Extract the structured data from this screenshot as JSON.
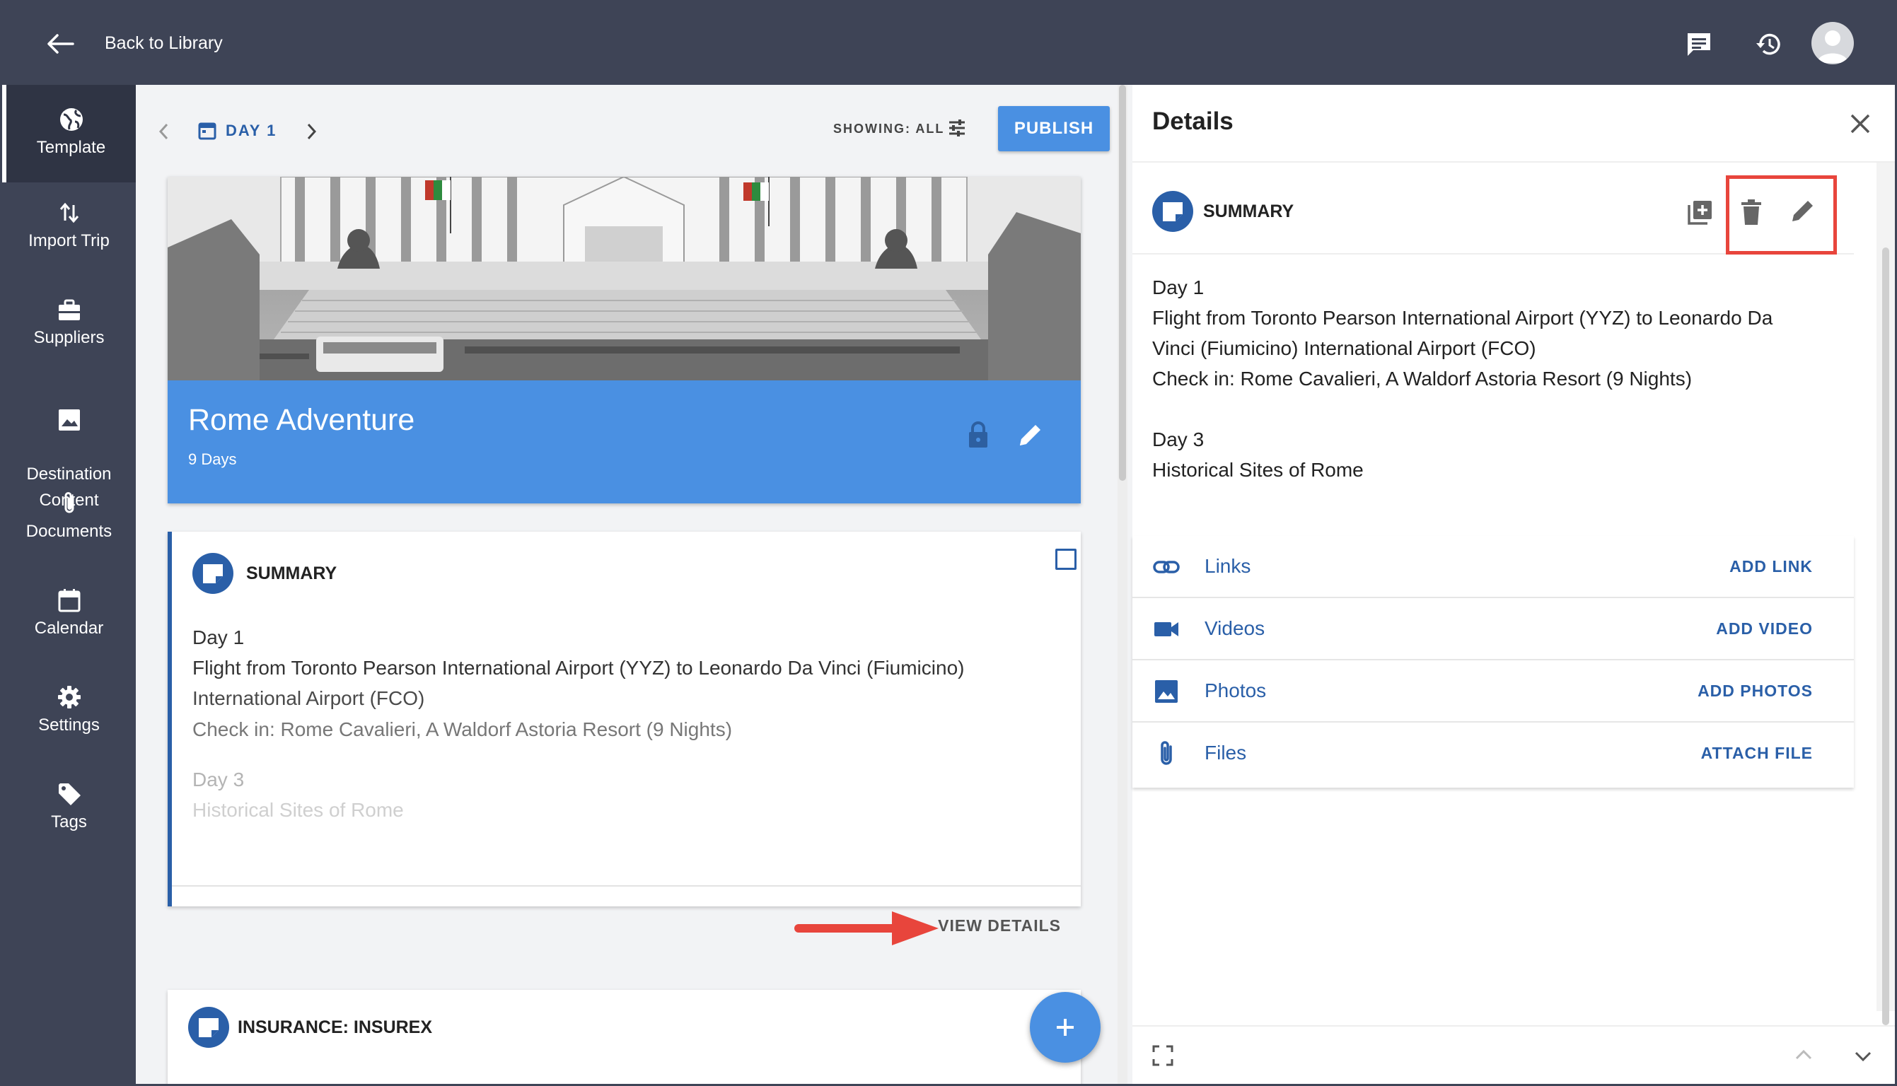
{
  "topbar": {
    "back_label": "Back to Library"
  },
  "sidebar": {
    "items": [
      {
        "label": "Template",
        "icon": "globe-icon"
      },
      {
        "label": "Import Trip",
        "icon": "import-arrows-icon"
      },
      {
        "label": "Suppliers",
        "icon": "briefcase-icon"
      },
      {
        "label": "Destination\nContent",
        "icon": "image-icon"
      },
      {
        "label": "Documents",
        "icon": "paperclip-icon"
      },
      {
        "label": "Calendar",
        "icon": "calendar-icon"
      },
      {
        "label": "Settings",
        "icon": "gear-icon"
      },
      {
        "label": "Tags",
        "icon": "tag-icon"
      }
    ]
  },
  "center": {
    "day_label": "DAY 1",
    "showing": "SHOWING: ALL",
    "publish": "PUBLISH",
    "hero": {
      "title": "Rome Adventure",
      "subtitle": "9 Days"
    },
    "summary_card": {
      "title": "SUMMARY",
      "lines": [
        "Day 1",
        "Flight from Toronto Pearson International Airport (YYZ) to Leonardo Da Vinci (Fiumicino)",
        "International Airport (FCO)",
        "Check in: Rome Cavalieri, A Waldorf Astoria Resort (9 Nights)",
        "Day 3",
        "Historical Sites of Rome"
      ],
      "view_details": "VIEW DETAILS"
    },
    "insurance_card": {
      "title": "INSURANCE: INSUREX"
    }
  },
  "details": {
    "title": "Details",
    "summary_title": "SUMMARY",
    "lines": [
      "Day 1",
      "Flight from Toronto Pearson International Airport (YYZ) to Leonardo Da",
      "Vinci (Fiumicino) International Airport (FCO)",
      "Check in: Rome Cavalieri, A Waldorf Astoria Resort (9 Nights)",
      "Day 3",
      "Historical Sites of Rome"
    ],
    "attachments": [
      {
        "label": "Links",
        "action": "ADD LINK",
        "icon": "link-icon"
      },
      {
        "label": "Videos",
        "action": "ADD VIDEO",
        "icon": "video-camera-icon"
      },
      {
        "label": "Photos",
        "action": "ADD PHOTOS",
        "icon": "photo-icon"
      },
      {
        "label": "Files",
        "action": "ATTACH FILE",
        "icon": "paperclip-icon"
      }
    ]
  },
  "colors": {
    "topbar": "#3e4456",
    "accent": "#4a90e2",
    "link": "#2a5fa8",
    "annotation": "#e8453c"
  }
}
